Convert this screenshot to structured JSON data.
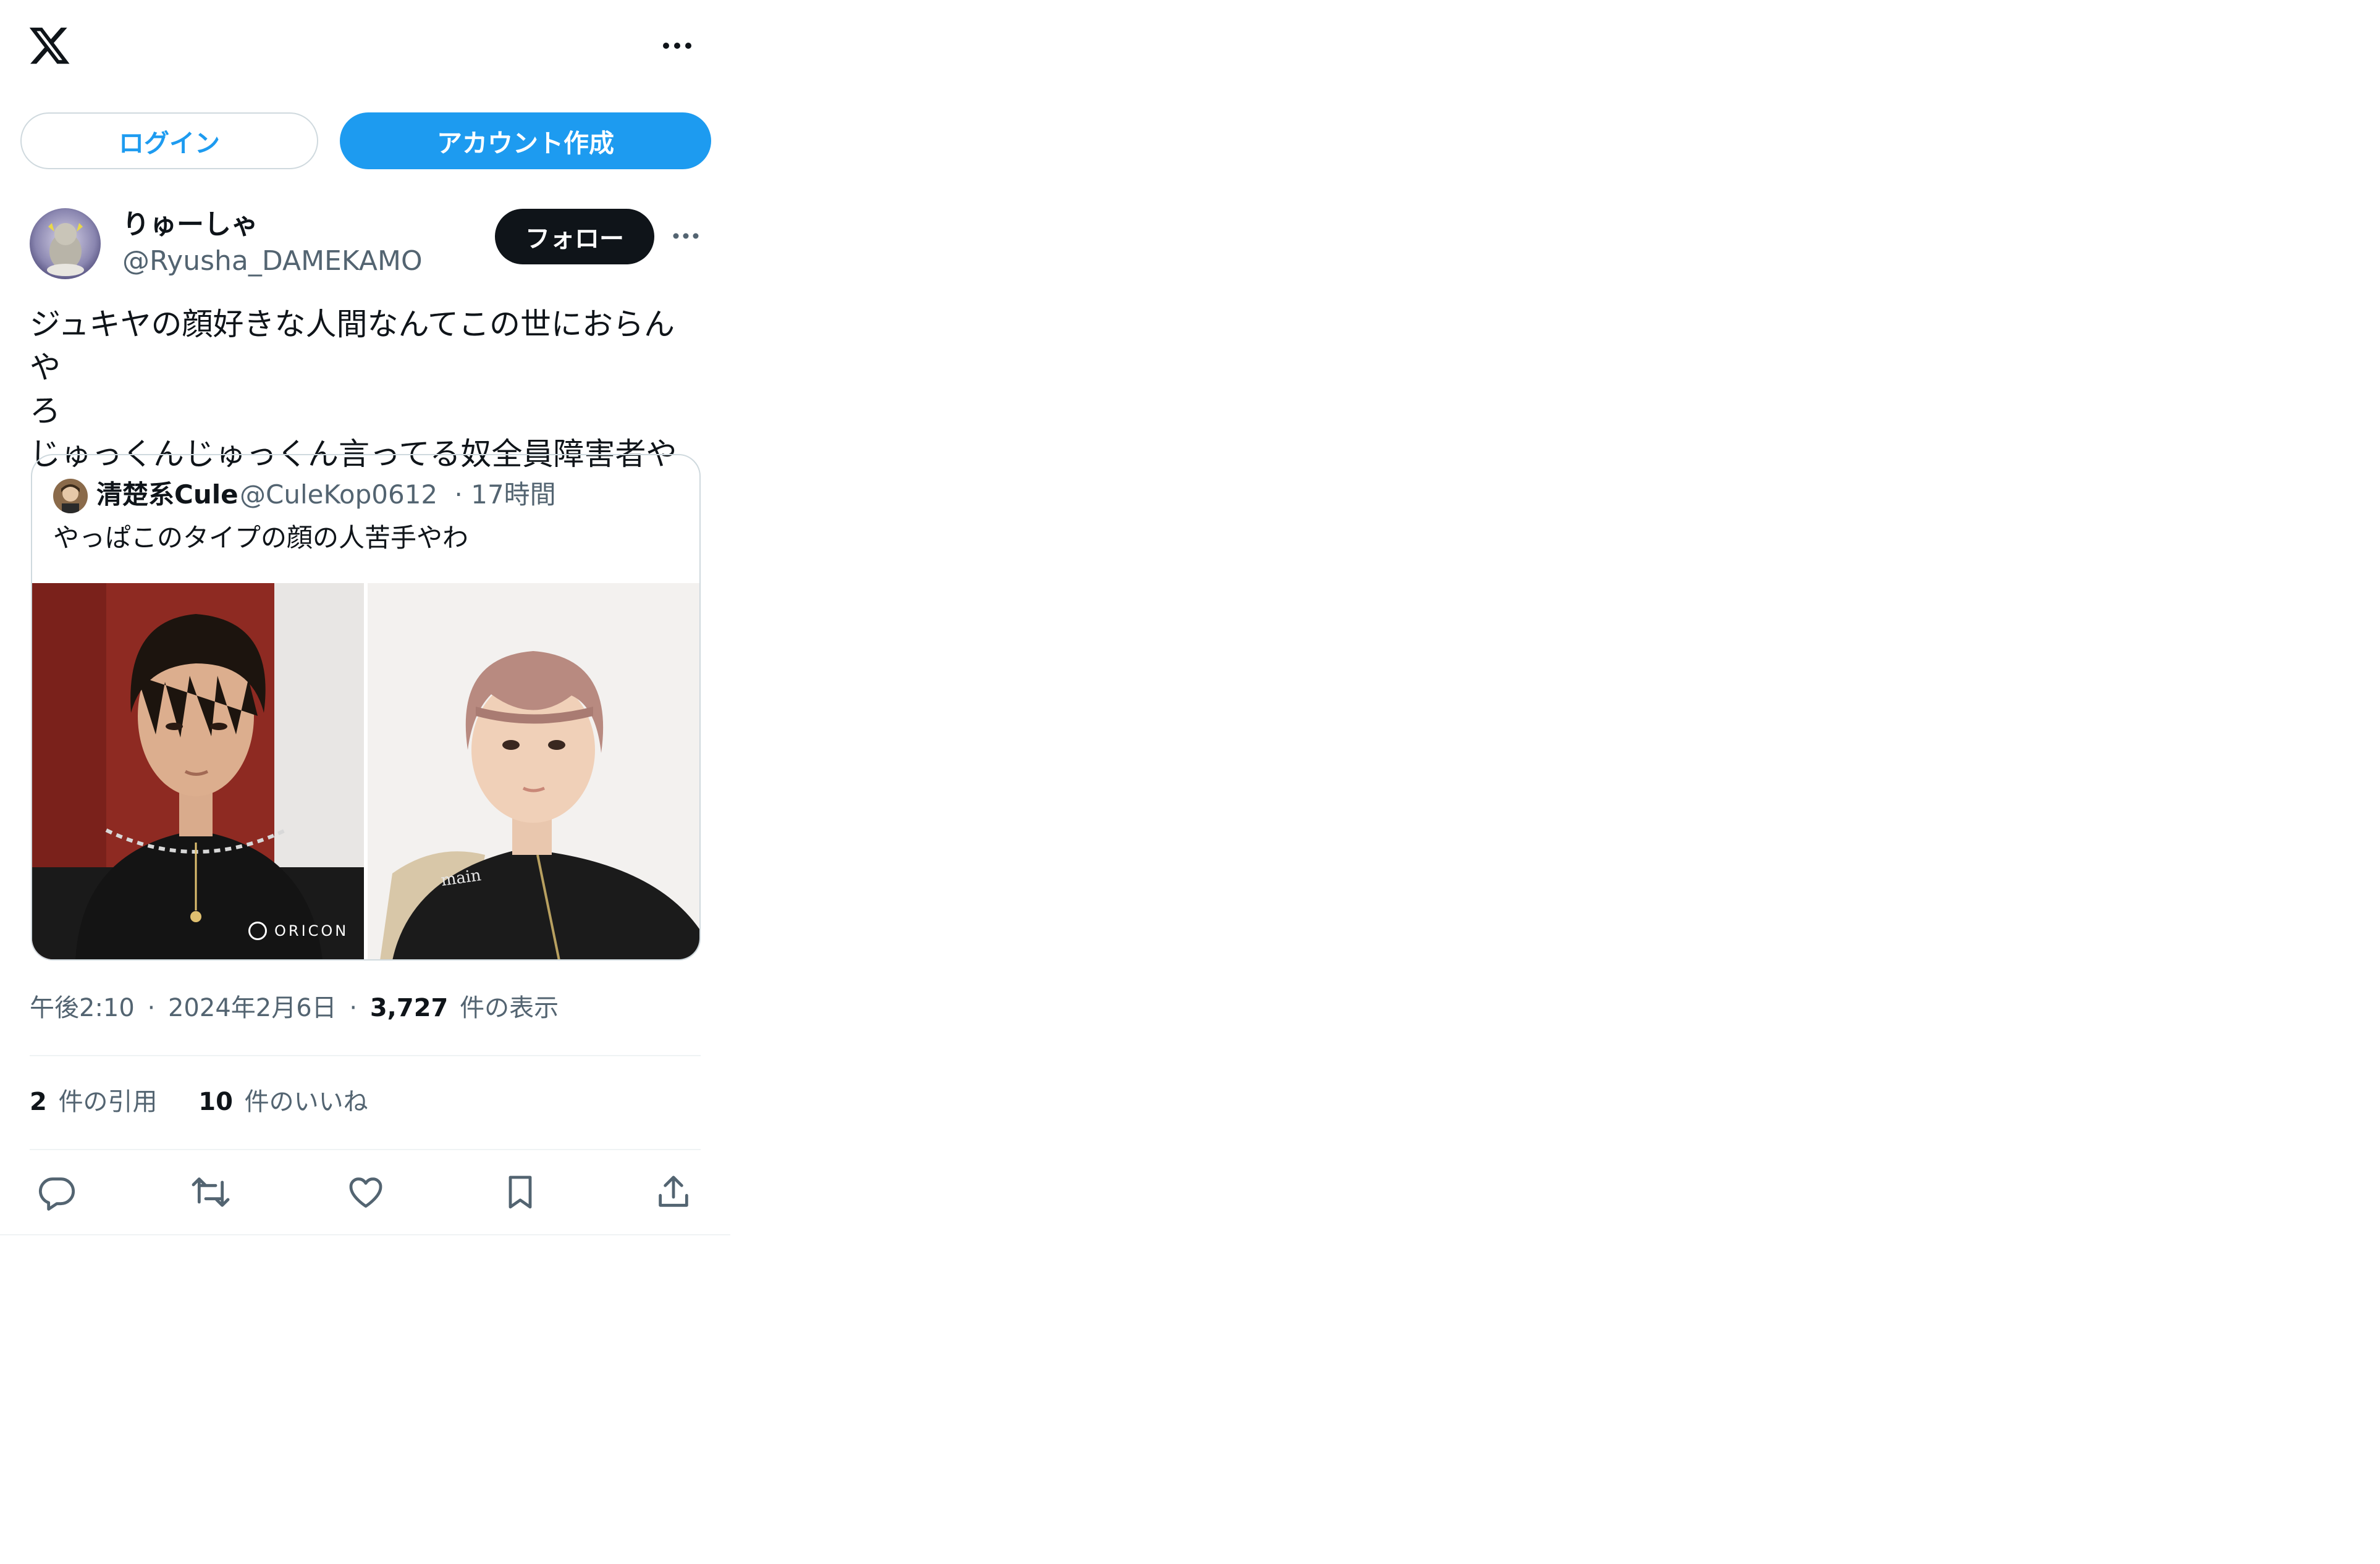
{
  "header": {
    "logo_icon": "x-logo-icon",
    "more_icon": "more-horizontal-icon",
    "login_label": "ログイン",
    "signup_label": "アカウント作成"
  },
  "tweet": {
    "author_name": "りゅーしゃ",
    "author_handle": "@Ryusha_DAMEKAMO",
    "follow_label": "フォロー",
    "text": "ジュキヤの顔好きな人間なんてこの世におらんや\nろ\nじゅっくんじゅっくん言ってる奴全員障害者や",
    "quote": {
      "author_name": "清楚系Cule",
      "author_handle": "@CuleKop0612",
      "time": "· 17時間",
      "text": "やっぱこのタイプの顔の人苦手やわ",
      "watermark": "ORICON"
    },
    "meta": {
      "time": "午後2:10",
      "date": "2024年2月6日",
      "views_count": "3,727",
      "views_label": "件の表示"
    },
    "stats": {
      "quotes_count": "2",
      "quotes_label": "件の引用",
      "likes_count": "10",
      "likes_label": "件のいいね"
    },
    "actions": [
      "reply-icon",
      "retweet-icon",
      "like-icon",
      "bookmark-icon",
      "share-icon"
    ]
  },
  "colors": {
    "accent": "#1d9bf0",
    "text": "#0f1419",
    "secondary": "#536471",
    "border": "#cfd9de"
  }
}
